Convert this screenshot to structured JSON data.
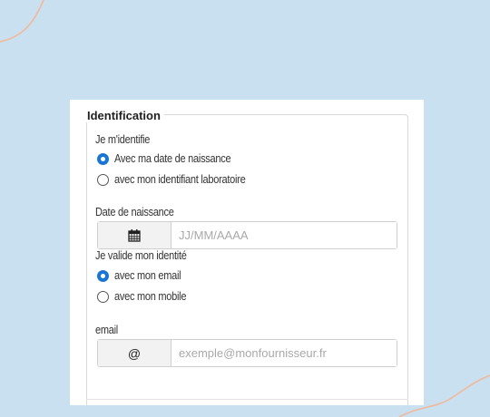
{
  "section": {
    "legend": "Identification"
  },
  "identify": {
    "label": "Je m'identifie",
    "options": [
      {
        "label": "Avec ma date de naissance",
        "checked": true
      },
      {
        "label": "avec mon identifiant laboratoire",
        "checked": false
      }
    ]
  },
  "birthdate": {
    "label": "Date de naissance",
    "icon": "calendar-icon",
    "placeholder": "JJ/MM/AAAA",
    "value": ""
  },
  "validate": {
    "label": "Je valide mon identité",
    "options": [
      {
        "label": "avec mon email",
        "checked": true
      },
      {
        "label": "avec mon mobile",
        "checked": false
      }
    ]
  },
  "email": {
    "label": "email",
    "addon": "@",
    "placeholder": "exemple@monfournisseur.fr",
    "value": ""
  },
  "colors": {
    "accent": "#1976d2",
    "background": "#c9e0f1",
    "decoration": "#f1b89a"
  }
}
